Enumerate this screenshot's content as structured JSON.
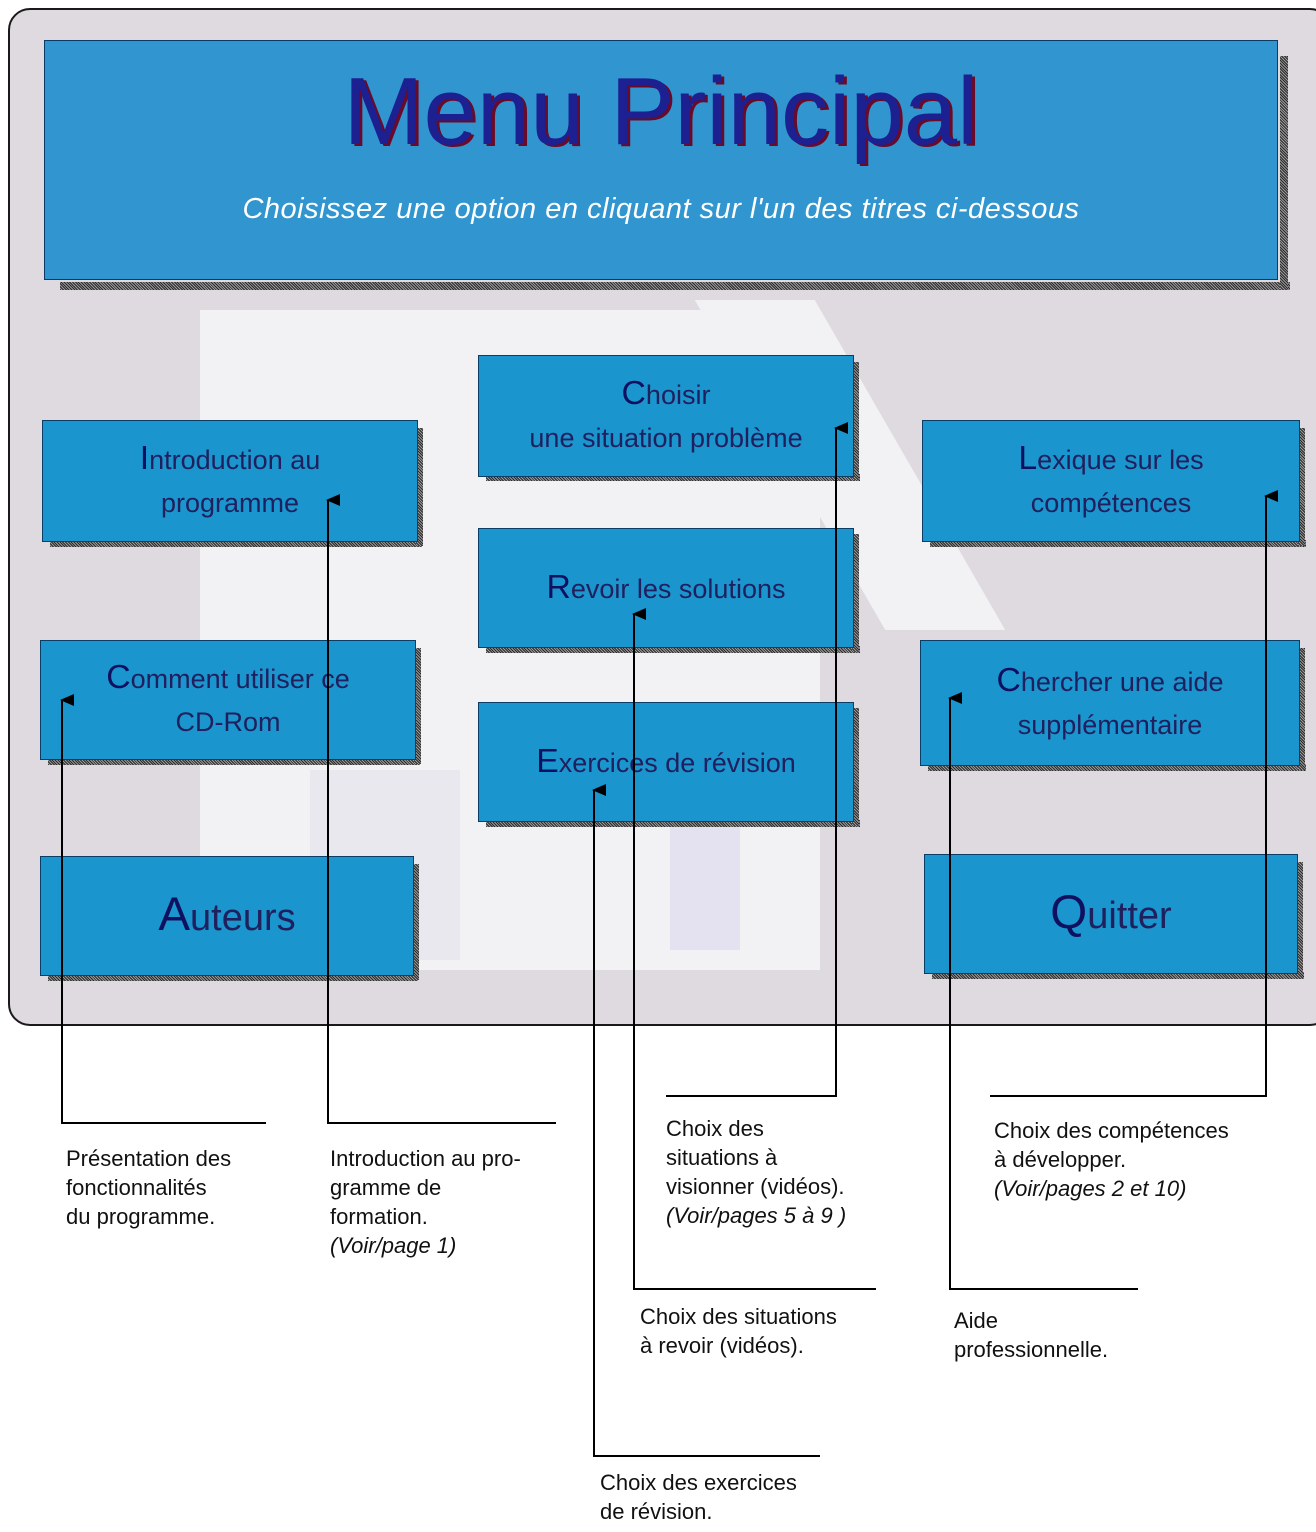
{
  "window": {
    "title": "Menu Principal",
    "subtitle": "Choisissez une option en cliquant sur l'un des titres ci-dessous"
  },
  "menu": {
    "introduction": {
      "initial": "I",
      "line1": "ntroduction au",
      "line2": "programme"
    },
    "comment": {
      "initial": "C",
      "line1": "omment utiliser ce",
      "line2": "CD-Rom"
    },
    "auteurs": {
      "initial": "A",
      "rest": "uteurs"
    },
    "choisir": {
      "initial": "C",
      "line1": "hoisir",
      "line2": "une situation problème"
    },
    "revoir": {
      "initial": "R",
      "rest": "evoir les solutions"
    },
    "exercices": {
      "initial": "E",
      "rest": "xercices de révision"
    },
    "lexique": {
      "initial": "L",
      "line1": "exique sur les",
      "line2": "compétences"
    },
    "chercher": {
      "initial": "C",
      "line1": "hercher une aide",
      "line2": "supplémentaire"
    },
    "quitter": {
      "initial": "Q",
      "rest": "uitter"
    }
  },
  "annotations": {
    "presentation": {
      "lines": [
        "Présentation des",
        "fonctionnalités",
        "du programme."
      ]
    },
    "introduction": {
      "lines": [
        "Introduction au pro-",
        "gramme de",
        "formation."
      ],
      "ref": "(Voir/page 1)"
    },
    "choix_situations": {
      "lines": [
        "Choix des",
        "situations à",
        "visionner (vidéos)."
      ],
      "ref": "(Voir/pages 5 à 9 )"
    },
    "choix_competences": {
      "lines": [
        "Choix des compétences",
        "à développer."
      ],
      "ref": "(Voir/pages 2 et 10)"
    },
    "choix_revoir": {
      "lines": [
        "Choix des situations",
        "à revoir (vidéos)."
      ]
    },
    "aide": {
      "lines": [
        "Aide",
        "professionnelle."
      ]
    },
    "choix_exercices": {
      "lines": [
        "Choix des exercices",
        "de révision."
      ]
    }
  }
}
